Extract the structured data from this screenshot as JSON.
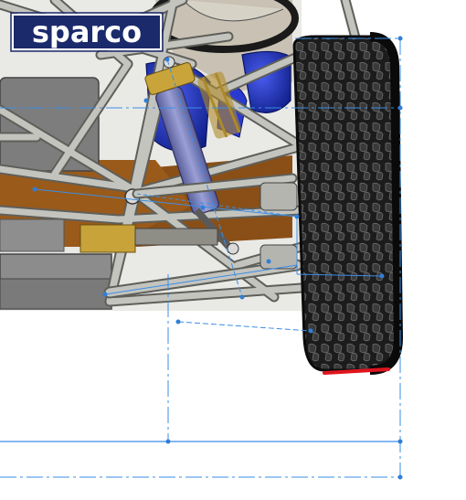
{
  "viewport": {
    "view_type": "cad-3d-model",
    "background_color": "#ffffff"
  },
  "logo": {
    "text": "sparco",
    "bg_color": "#1b2a6b",
    "text_color": "#ffffff"
  },
  "model": {
    "frame_color": "#b9b9b4",
    "frame_edge_color": "#5f5f5a",
    "shock_body_color": "#7c80b8",
    "shock_spring_color": "#a68a2a",
    "seat_blue_color": "#1f2fb8",
    "tire_color": "#1c1c1c",
    "hub_brown_color": "#9a5a1a",
    "ground_contact_color": "#e0141e"
  },
  "sketch": {
    "line_color": "#3a8ee6",
    "point_color": "#2f7fd8"
  }
}
